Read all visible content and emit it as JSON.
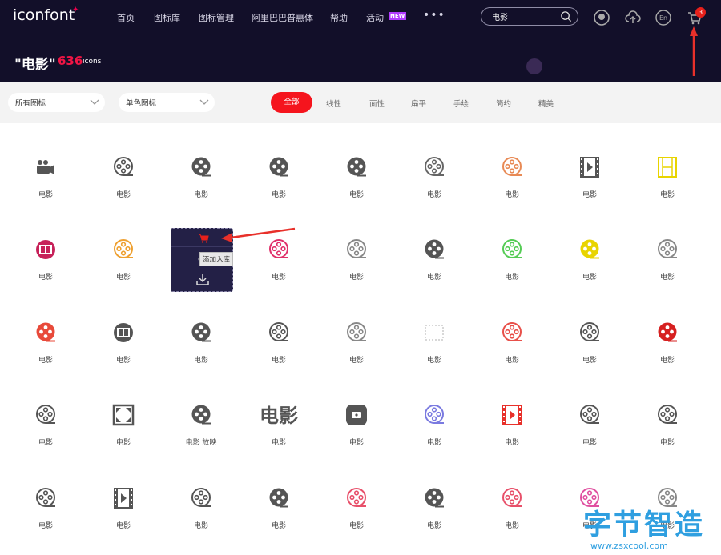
{
  "nav": {
    "logo": "iconfont",
    "items": [
      "首页",
      "图标库",
      "图标管理",
      "阿里巴巴普惠体",
      "帮助",
      "活动"
    ],
    "new_badge": "NEW",
    "more": "•••",
    "search_value": "电影",
    "lang": "En",
    "cart_count": "3"
  },
  "hero": {
    "title": "\"电影\"",
    "count": "636",
    "unit": "icons"
  },
  "filters": {
    "dropdown1": "所有图标",
    "dropdown2": "单色图标",
    "tabs": [
      "全部",
      "线性",
      "面性",
      "扁平",
      "手绘",
      "简约",
      "精美"
    ],
    "active_tab": "全部"
  },
  "hover_card": {
    "tooltip": "添加入库"
  },
  "icons": [
    {
      "label": "电影",
      "glyph": "camera",
      "color": "#555555"
    },
    {
      "label": "电影",
      "glyph": "reel-outline",
      "color": "#555555"
    },
    {
      "label": "电影",
      "glyph": "reel-filled",
      "color": "#555555"
    },
    {
      "label": "电影",
      "glyph": "reel-filled",
      "color": "#555555"
    },
    {
      "label": "电影",
      "glyph": "reel-filled",
      "color": "#555555"
    },
    {
      "label": "电影",
      "glyph": "reel-outline",
      "color": "#666666"
    },
    {
      "label": "电影",
      "glyph": "reel-outline",
      "color": "#e88a55"
    },
    {
      "label": "电影",
      "glyph": "filmstrip",
      "color": "#555555"
    },
    {
      "label": "电影",
      "glyph": "filmstrip-outline",
      "color": "#e8d400"
    },
    {
      "label": "电影",
      "glyph": "ticket-circle",
      "color": "#c7225a"
    },
    {
      "label": "电影",
      "glyph": "reel-outline",
      "color": "#eea030"
    },
    {
      "label": "电影",
      "glyph": "none",
      "color": "#555555"
    },
    {
      "label": "电影",
      "glyph": "reel-outline",
      "color": "#e0306a"
    },
    {
      "label": "电影",
      "glyph": "reel-outline",
      "color": "#888888"
    },
    {
      "label": "电影",
      "glyph": "reel-filled",
      "color": "#555555"
    },
    {
      "label": "电影",
      "glyph": "reel-outline",
      "color": "#55cc55"
    },
    {
      "label": "电影",
      "glyph": "reel-filled",
      "color": "#e8d400"
    },
    {
      "label": "电影",
      "glyph": "reel-outline",
      "color": "#888888"
    },
    {
      "label": "电影",
      "glyph": "reel-filled",
      "color": "#e84a3a"
    },
    {
      "label": "电影",
      "glyph": "ticket-circle",
      "color": "#555555"
    },
    {
      "label": "电影",
      "glyph": "reel-filled",
      "color": "#555555"
    },
    {
      "label": "电影",
      "glyph": "reel-outline",
      "color": "#555555"
    },
    {
      "label": "电影",
      "glyph": "reel-outline",
      "color": "#888888"
    },
    {
      "label": "电影",
      "glyph": "dotted",
      "color": "#cccccc"
    },
    {
      "label": "电影",
      "glyph": "reel-outline",
      "color": "#e8504a"
    },
    {
      "label": "电影",
      "glyph": "reel-outline",
      "color": "#555555"
    },
    {
      "label": "电影",
      "glyph": "reel-filled",
      "color": "#d62020"
    },
    {
      "label": "电影",
      "glyph": "reel-outline",
      "color": "#555555"
    },
    {
      "label": "电影",
      "glyph": "frame",
      "color": "#555555"
    },
    {
      "label": "电影 放映",
      "glyph": "reel-filled",
      "color": "#555555"
    },
    {
      "label": "电影",
      "glyph": "text",
      "color": "#555555"
    },
    {
      "label": "电影",
      "glyph": "ticket-square",
      "color": "#555555"
    },
    {
      "label": "电影",
      "glyph": "reel-outline",
      "color": "#7a7ae0"
    },
    {
      "label": "电影",
      "glyph": "filmstrip",
      "color": "#e8302a"
    },
    {
      "label": "电影",
      "glyph": "reel-outline",
      "color": "#555555"
    },
    {
      "label": "电影",
      "glyph": "reel-outline",
      "color": "#555555"
    },
    {
      "label": "电影",
      "glyph": "reel-outline",
      "color": "#555555"
    },
    {
      "label": "电影",
      "glyph": "filmstrip",
      "color": "#555555"
    },
    {
      "label": "电影",
      "glyph": "reel-outline",
      "color": "#555555"
    },
    {
      "label": "电影",
      "glyph": "reel-filled",
      "color": "#555555"
    },
    {
      "label": "电影",
      "glyph": "reel-outline",
      "color": "#e8506a"
    },
    {
      "label": "电影",
      "glyph": "reel-filled",
      "color": "#555555"
    },
    {
      "label": "电影",
      "glyph": "reel-outline",
      "color": "#e8506a"
    },
    {
      "label": "电影",
      "glyph": "reel-outline",
      "color": "#e050a0"
    },
    {
      "label": "电影",
      "glyph": "reel-outline",
      "color": "#888888"
    }
  ],
  "watermark": {
    "cn": "字节智造",
    "url": "www.zsxcool.com"
  },
  "colors": {
    "nav_bg": "#120f29",
    "accent": "#f5141d",
    "count": "#f01545"
  }
}
